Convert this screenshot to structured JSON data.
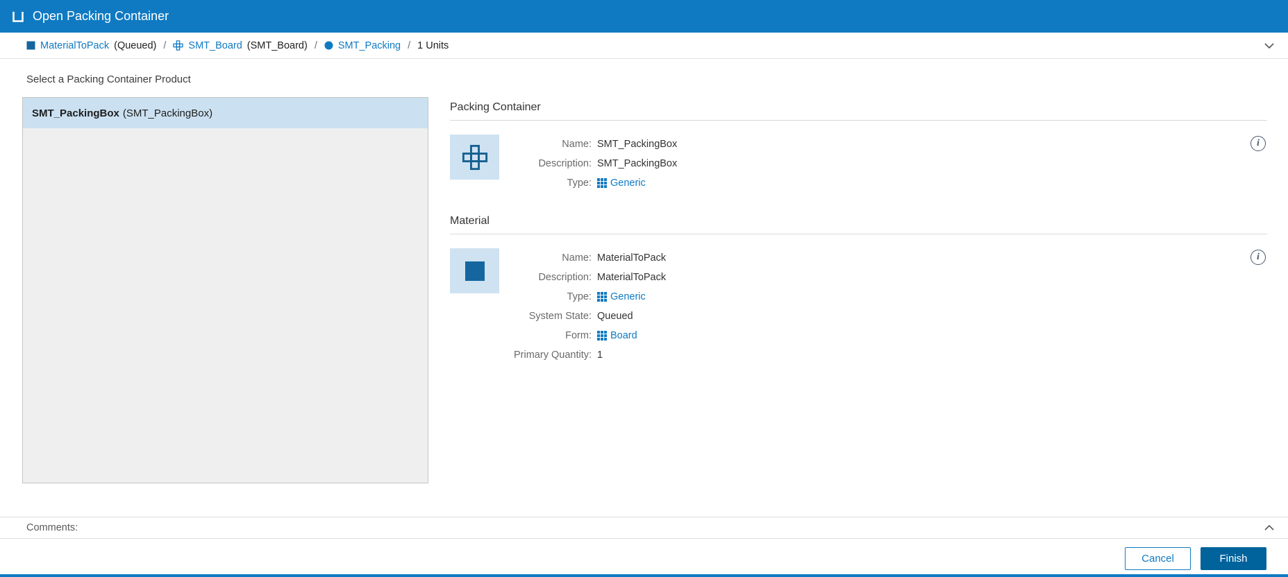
{
  "colors": {
    "primary_blue": "#0f7ac2",
    "finish_button_bg": "#00639c",
    "selected_item_bg": "#cbe1f1",
    "thumbnail_bg": "#cfe2f1",
    "glyph_blue": "#15659f",
    "link_blue": "#0f7ac2"
  },
  "header": {
    "title": "Open Packing Container"
  },
  "breadcrumb": {
    "items": [
      {
        "label": "MaterialToPack",
        "suffix": "(Queued)"
      },
      {
        "label": "SMT_Board",
        "suffix": "(SMT_Board)"
      },
      {
        "label": "SMT_Packing",
        "suffix": ""
      }
    ],
    "separator": "/",
    "units": "1 Units"
  },
  "main": {
    "select_label": "Select a Packing Container Product",
    "product_list": [
      {
        "name": "SMT_PackingBox",
        "suffix": "(SMT_PackingBox)"
      }
    ],
    "packing_container": {
      "title": "Packing Container",
      "fields": {
        "name_label": "Name:",
        "name": "SMT_PackingBox",
        "description_label": "Description:",
        "description": "SMT_PackingBox",
        "type_label": "Type:",
        "type": "Generic"
      }
    },
    "material": {
      "title": "Material",
      "fields": {
        "name_label": "Name:",
        "name": "MaterialToPack",
        "description_label": "Description:",
        "description": "MaterialToPack",
        "type_label": "Type:",
        "type": "Generic",
        "system_state_label": "System State:",
        "system_state": "Queued",
        "form_label": "Form:",
        "form": "Board",
        "primary_quantity_label": "Primary Quantity:",
        "primary_quantity": "1"
      }
    }
  },
  "comments": {
    "label": "Comments:"
  },
  "footer": {
    "cancel": "Cancel",
    "finish": "Finish"
  }
}
